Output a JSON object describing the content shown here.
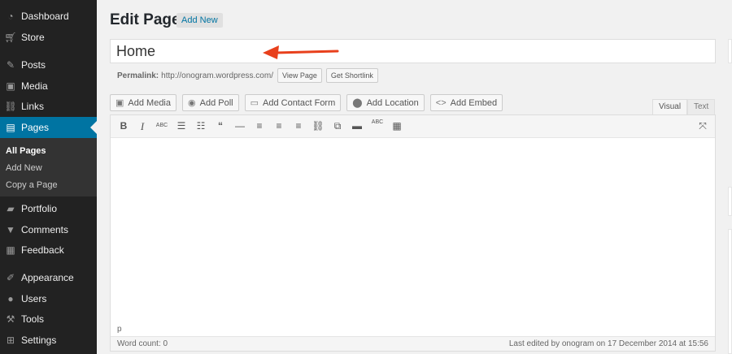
{
  "sidebar": {
    "items": [
      {
        "label": "Dashboard",
        "icon": "dashboard-icon"
      },
      {
        "label": "Store",
        "icon": "cart-icon"
      },
      {
        "label": "Posts",
        "icon": "pushpin-icon"
      },
      {
        "label": "Media",
        "icon": "media-icon"
      },
      {
        "label": "Links",
        "icon": "link-icon"
      },
      {
        "label": "Pages",
        "icon": "pages-icon"
      },
      {
        "label": "Portfolio",
        "icon": "folder-icon"
      },
      {
        "label": "Comments",
        "icon": "comment-icon"
      },
      {
        "label": "Feedback",
        "icon": "feedback-icon"
      },
      {
        "label": "Appearance",
        "icon": "brush-icon"
      },
      {
        "label": "Users",
        "icon": "user-icon"
      },
      {
        "label": "Tools",
        "icon": "wrench-icon"
      },
      {
        "label": "Settings",
        "icon": "settings-icon"
      }
    ],
    "submenu": [
      "All Pages",
      "Add New",
      "Copy a Page"
    ],
    "accent_color": "#0074a2"
  },
  "header": {
    "title": "Edit Page",
    "add_new": "Add New"
  },
  "editor": {
    "title_value": "Home",
    "permalink_label": "Permalink:",
    "permalink_url": "http://onogram.wordpress.com/",
    "view_page": "View Page",
    "get_shortlink": "Get Shortlink",
    "media_buttons": [
      {
        "label": "Add Media",
        "icon": "media-icon"
      },
      {
        "label": "Add Poll",
        "icon": "poll-icon"
      },
      {
        "label": "Add Contact Form",
        "icon": "form-icon"
      },
      {
        "label": "Add Location",
        "icon": "location-pin-icon"
      },
      {
        "label": "Add Embed",
        "icon": "embed-icon"
      }
    ],
    "tabs": {
      "visual": "Visual",
      "text": "Text"
    },
    "toolbar": {
      "bold": "B",
      "italic": "I",
      "strikethrough": "ABC",
      "quote": "“",
      "hr": "—",
      "spellcheck": "ABC"
    },
    "path": "p",
    "word_count": "Word count: 0",
    "last_edited": "Last edited by onogram on 17 December 2014 at 15:56"
  },
  "annotation": {
    "arrow_color": "#e8401c"
  }
}
